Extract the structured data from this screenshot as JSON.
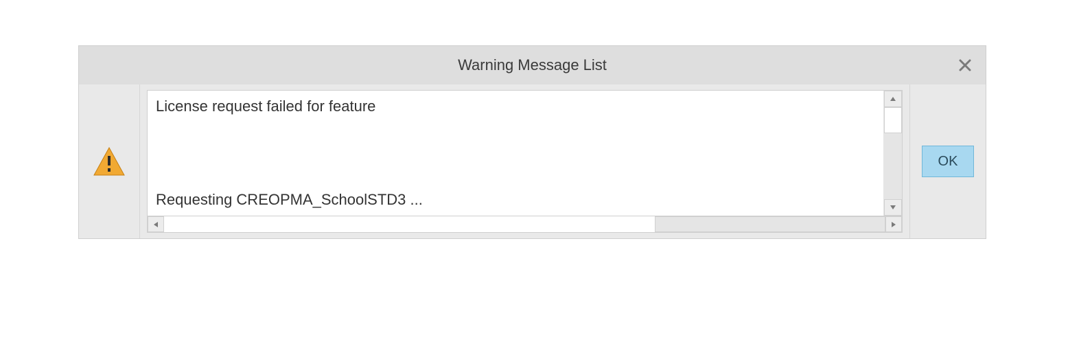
{
  "dialog": {
    "title": "Warning Message List",
    "icon": "warning-icon",
    "messages": {
      "line1": "License request failed for feature",
      "line2": "Requesting CREOPMA_SchoolSTD3 ..."
    },
    "ok_label": "OK",
    "colors": {
      "ok_bg": "#a8d8f0",
      "ok_border": "#6fb7d9",
      "warning_fill": "#f1a933",
      "warning_bang": "#2b2b2b"
    }
  }
}
